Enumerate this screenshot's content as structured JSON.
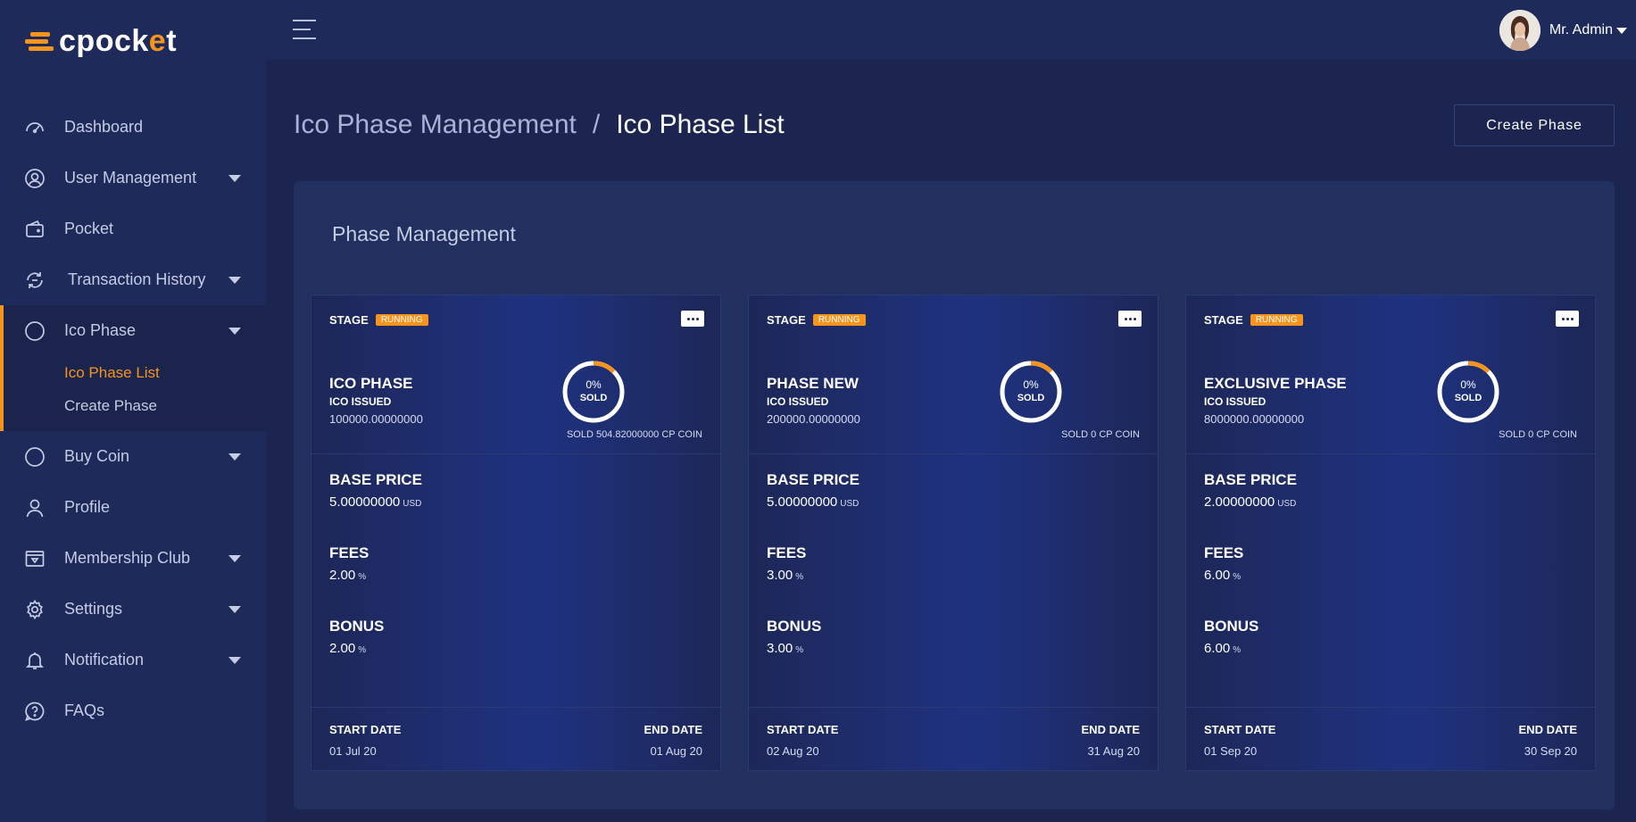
{
  "brand": {
    "logo_text": "cpocket",
    "accent": "#f7941d",
    "sidebar_bg": "#1e2a5a",
    "page_bg": "#1b2550"
  },
  "sidebar": {
    "items": [
      {
        "label": "Dashboard",
        "icon": "dashboard-gauge-icon"
      },
      {
        "label": "User Management",
        "icon": "user-circle-icon"
      },
      {
        "label": "Pocket",
        "icon": "wallet-icon"
      },
      {
        "label": "Transaction History",
        "icon": "exchange-icon"
      },
      {
        "label": "Ico Phase",
        "icon": "circle-icon"
      },
      {
        "label": "Buy Coin",
        "icon": "circle-icon"
      },
      {
        "label": "Profile",
        "icon": "user-icon"
      },
      {
        "label": "Membership Club",
        "icon": "membership-card-icon"
      },
      {
        "label": "Settings",
        "icon": "gear-icon"
      },
      {
        "label": "Notification",
        "icon": "bell-icon"
      },
      {
        "label": "FAQs",
        "icon": "question-bubble-icon"
      }
    ],
    "ico_sub": [
      {
        "label": "Ico Phase List",
        "active": true
      },
      {
        "label": "Create Phase",
        "active": false
      }
    ]
  },
  "topbar": {
    "user_name": "Mr. Admin"
  },
  "header": {
    "crumb_parent": "Ico Phase Management",
    "crumb_separator": "/",
    "crumb_current": "Ico Phase List",
    "create_button": "Create Phase"
  },
  "panel": {
    "title": "Phase Management"
  },
  "cards": [
    {
      "stage_label": "STAGE",
      "status": "RUNNING",
      "name": "ICO PHASE",
      "issued_label": "ICO ISSUED",
      "issued_value": "100000.00000000",
      "sold_percent": "0%",
      "sold_label": "SOLD",
      "sold_text": "SOLD 504.82000000 CP COIN",
      "base_price_label": "BASE PRICE",
      "base_price": "5.00000000",
      "base_price_unit": "USD",
      "fees_label": "FEES",
      "fees": "2.00",
      "fees_unit": "%",
      "bonus_label": "BONUS",
      "bonus": "2.00",
      "bonus_unit": "%",
      "start_label": "START DATE",
      "start_date": "01 Jul 20",
      "end_label": "END DATE",
      "end_date": "01 Aug 20"
    },
    {
      "stage_label": "STAGE",
      "status": "RUNNING",
      "name": "PHASE NEW",
      "issued_label": "ICO ISSUED",
      "issued_value": "200000.00000000",
      "sold_percent": "0%",
      "sold_label": "SOLD",
      "sold_text": "SOLD 0 CP COIN",
      "base_price_label": "BASE PRICE",
      "base_price": "5.00000000",
      "base_price_unit": "USD",
      "fees_label": "FEES",
      "fees": "3.00",
      "fees_unit": "%",
      "bonus_label": "BONUS",
      "bonus": "3.00",
      "bonus_unit": "%",
      "start_label": "START DATE",
      "start_date": "02 Aug 20",
      "end_label": "END DATE",
      "end_date": "31 Aug 20"
    },
    {
      "stage_label": "STAGE",
      "status": "RUNNING",
      "name": "EXCLUSIVE PHASE",
      "issued_label": "ICO ISSUED",
      "issued_value": "8000000.00000000",
      "sold_percent": "0%",
      "sold_label": "SOLD",
      "sold_text": "SOLD 0 CP COIN",
      "base_price_label": "BASE PRICE",
      "base_price": "2.00000000",
      "base_price_unit": "USD",
      "fees_label": "FEES",
      "fees": "6.00",
      "fees_unit": "%",
      "bonus_label": "BONUS",
      "bonus": "6.00",
      "bonus_unit": "%",
      "start_label": "START DATE",
      "start_date": "01 Sep 20",
      "end_label": "END DATE",
      "end_date": "30 Sep 20"
    }
  ]
}
